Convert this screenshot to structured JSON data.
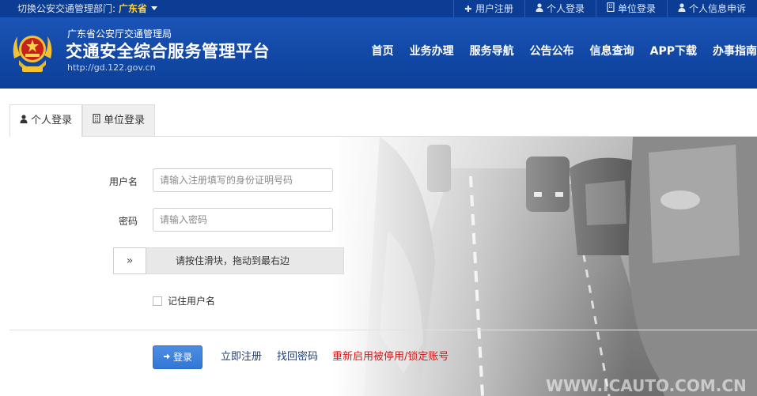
{
  "topbar": {
    "switch_label": "切换公安交通管理部门: ",
    "region": "广东省",
    "links": [
      {
        "icon": "plus-icon",
        "label": "用户注册"
      },
      {
        "icon": "user-icon",
        "label": "个人登录"
      },
      {
        "icon": "building-icon",
        "label": "单位登录"
      },
      {
        "icon": "user-icon",
        "label": "个人信息申诉"
      }
    ]
  },
  "header": {
    "org": "广东省公安厅交通管理局",
    "platform": "交通安全综合服务管理平台",
    "url": "http://gd.122.gov.cn",
    "nav": [
      "首页",
      "业务办理",
      "服务导航",
      "公告公布",
      "信息查询",
      "APP下载",
      "办事指南"
    ]
  },
  "tabs": [
    {
      "icon": "user-icon",
      "label": "个人登录",
      "active": true
    },
    {
      "icon": "building-icon",
      "label": "单位登录",
      "active": false
    }
  ],
  "form": {
    "username_label": "用户名",
    "username_placeholder": "请输入注册填写的身份证明号码",
    "password_label": "密码",
    "password_placeholder": "请输入密码",
    "slider_handle": "»",
    "slider_text": "请按住滑块，拖动到最右边",
    "remember_label": "记住用户名"
  },
  "actions": {
    "login": "登录",
    "register": "立即注册",
    "recover": "找回密码",
    "reactivate": "重新启用被停用/锁定账号"
  },
  "colors": {
    "topbar": "#0a3d93",
    "header": "#134aa8",
    "region": "#ffd23f",
    "login_button": "#3277d6",
    "warning_link": "#d01a1a"
  }
}
